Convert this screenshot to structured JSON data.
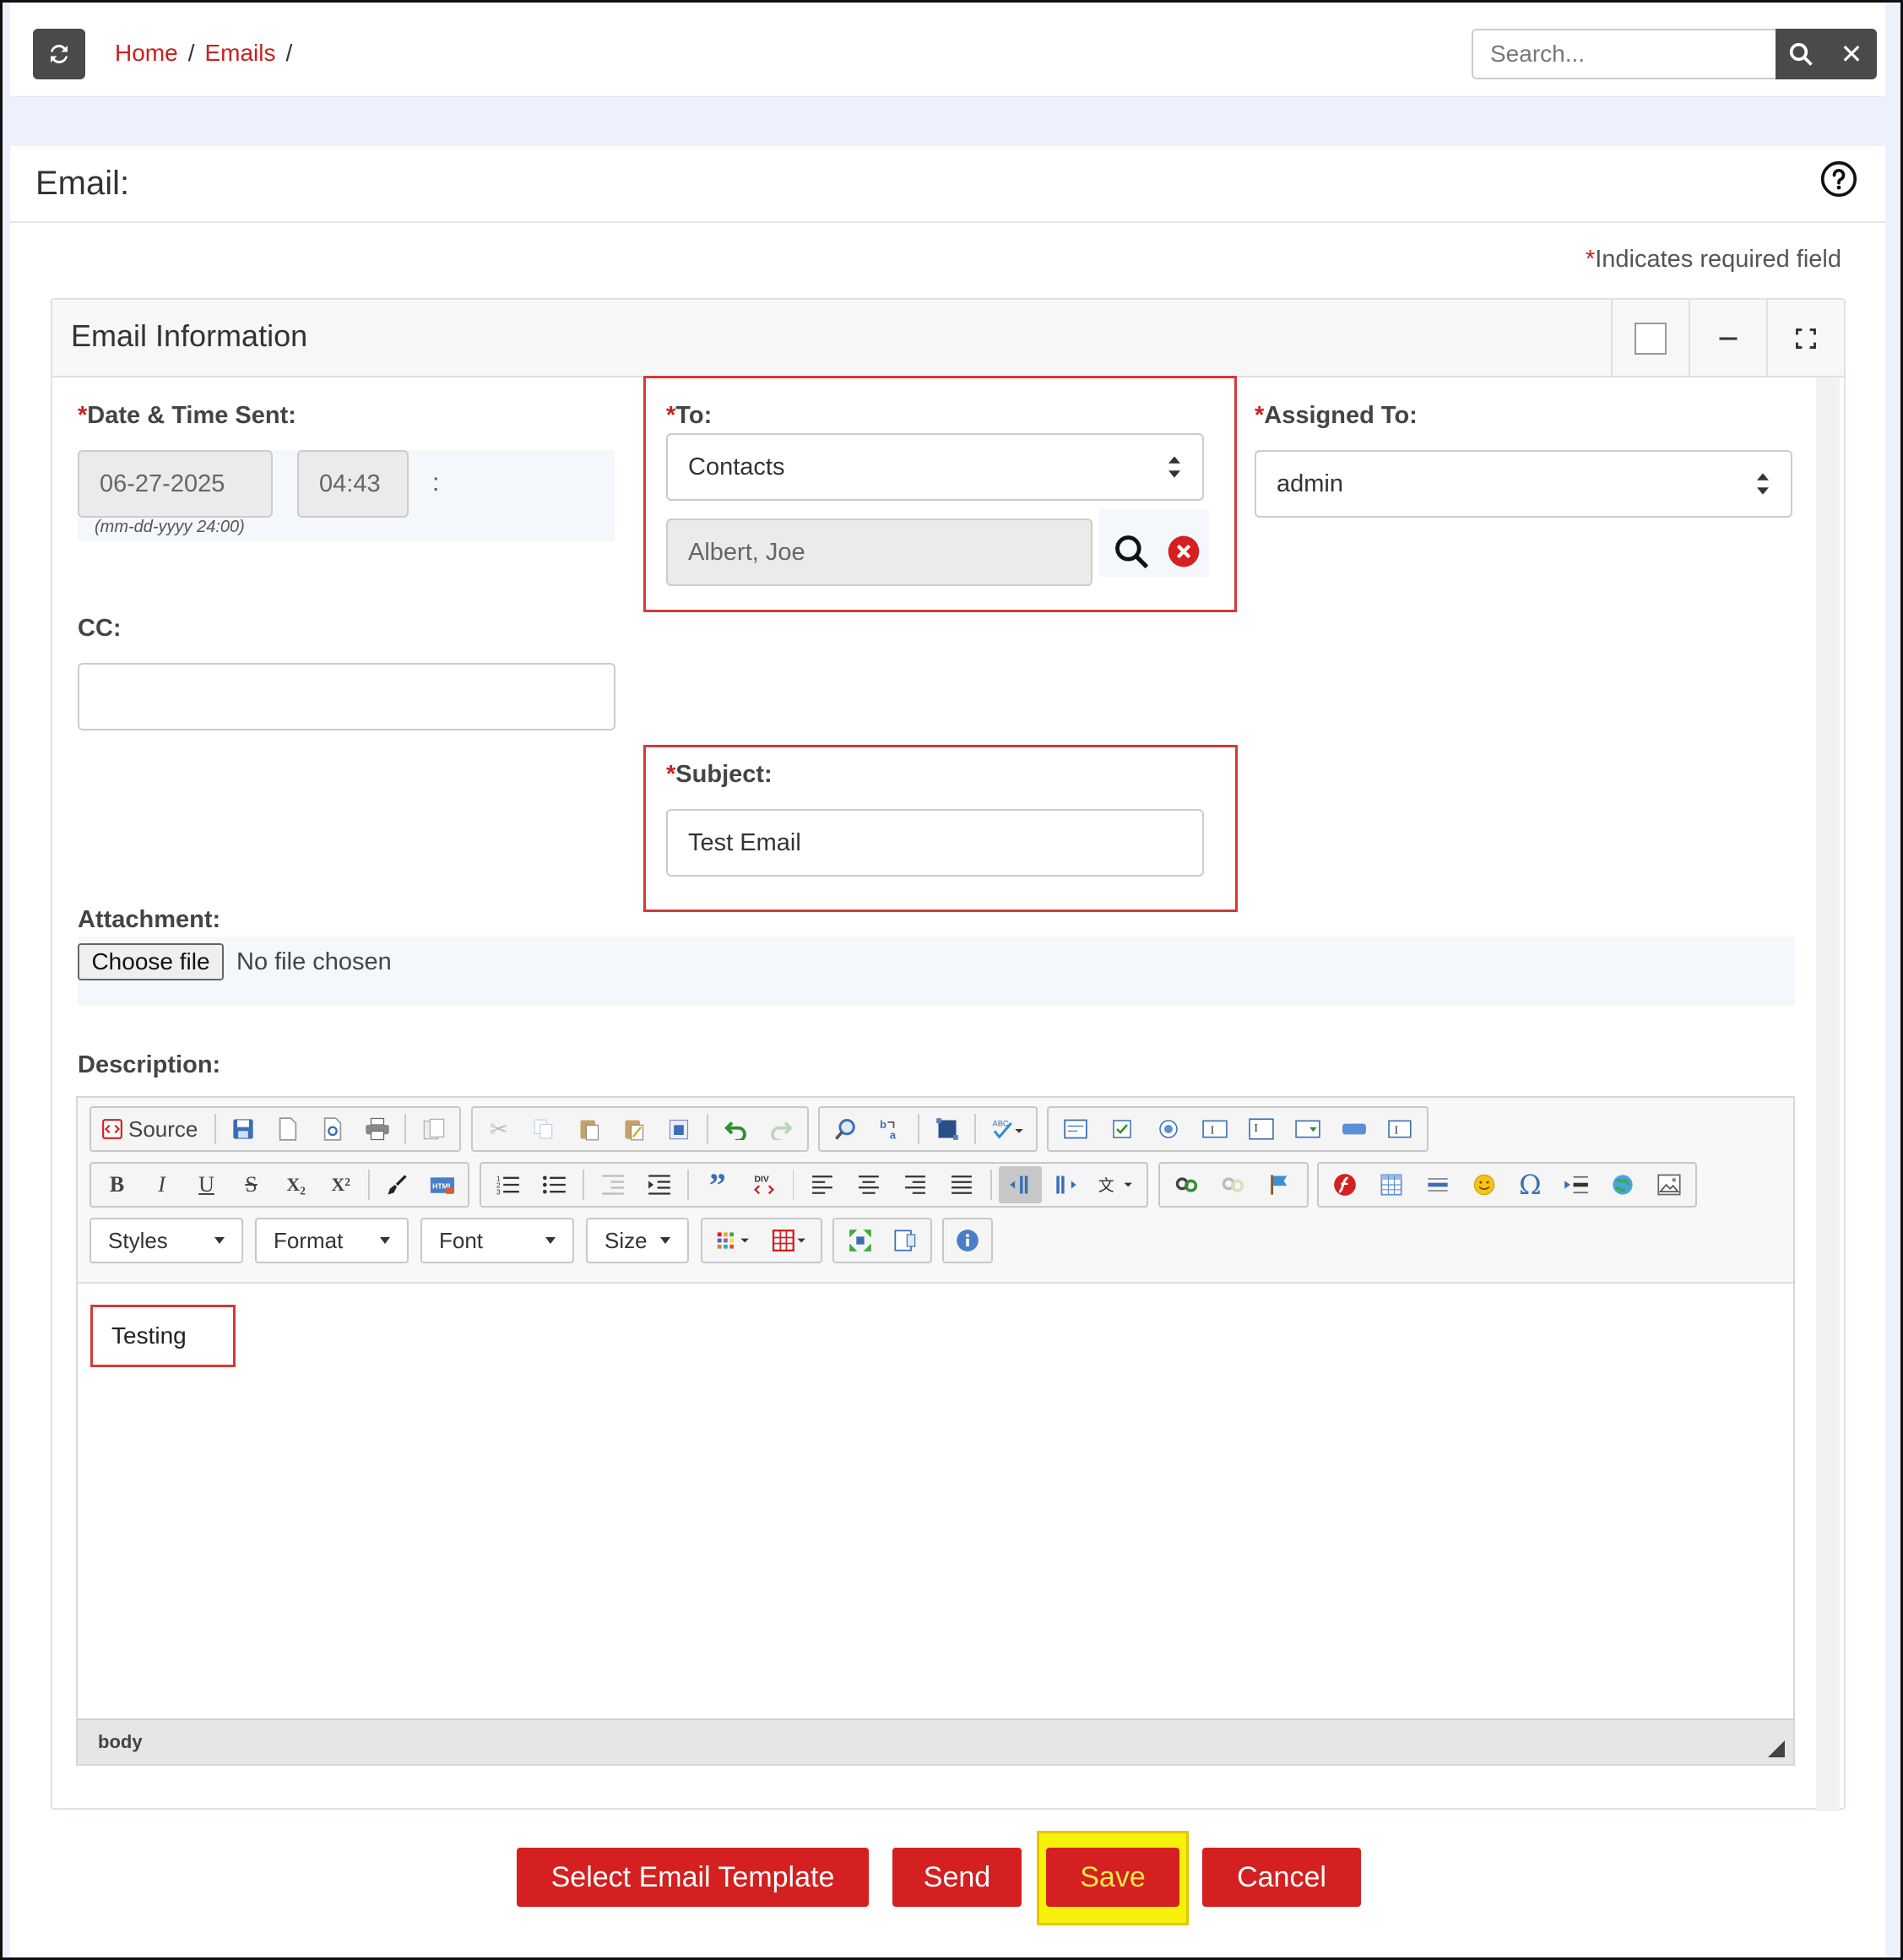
{
  "breadcrumb": {
    "home": "Home",
    "emails": "Emails",
    "sep": "/"
  },
  "search": {
    "placeholder": "Search..."
  },
  "page": {
    "title": "Email:",
    "required_asterisk": "*",
    "required_note": "Indicates required field"
  },
  "card": {
    "title": "Email Information"
  },
  "fields": {
    "date_time_label": "Date & Time Sent:",
    "date_value": "06-27-2025",
    "time_value": "04:43",
    "time_colon": ":",
    "date_hint": "(mm-dd-yyyy 24:00)",
    "to_label": "To:",
    "to_type": "Contacts",
    "to_value": "Albert, Joe",
    "assigned_label": "Assigned To:",
    "assigned_value": "admin",
    "cc_label": "CC:",
    "cc_value": "",
    "subject_label": "Subject:",
    "subject_value": "Test Email",
    "attachment_label": "Attachment:",
    "choose_file": "Choose file",
    "no_file": "No file chosen",
    "description_label": "Description:"
  },
  "editor": {
    "source_label": "Source",
    "bold": "B",
    "italic": "I",
    "underline": "U",
    "strike": "S",
    "subscript": "X₂",
    "superscript": "X²",
    "styles": "Styles",
    "format": "Format",
    "font": "Font",
    "size": "Size",
    "content": "Testing",
    "status": "body"
  },
  "buttons": {
    "select_template": "Select Email Template",
    "send": "Send",
    "save": "Save",
    "cancel": "Cancel"
  },
  "colors": {
    "accent": "#d42020",
    "link": "#cc1f1f",
    "highlight": "#f5f10a"
  }
}
